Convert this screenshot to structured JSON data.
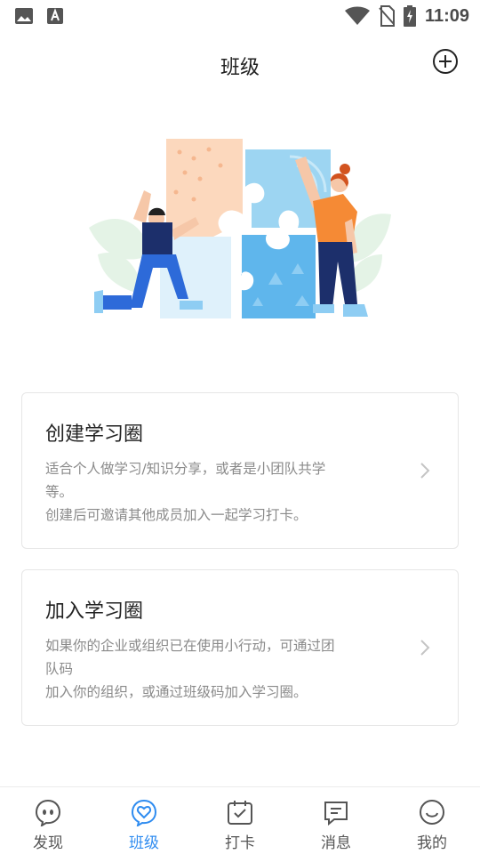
{
  "status_bar": {
    "time": "11:09",
    "left_icons": [
      "image-icon",
      "font-app-icon"
    ],
    "right_icons": [
      "wifi-icon",
      "no-sim-icon",
      "battery-charging-icon"
    ]
  },
  "header": {
    "title": "班级",
    "add_icon": "plus-circle-icon"
  },
  "illustration": {
    "subject": "two-people-assembling-puzzle"
  },
  "cards": [
    {
      "title": "创建学习圈",
      "desc_line1": "适合个人做学习/知识分享，或者是小团队共学",
      "desc_line2": "等。",
      "desc_line3": "创建后可邀请其他成员加入一起学习打卡。"
    },
    {
      "title": "加入学习圈",
      "desc_line1": "如果你的企业或组织已在使用小行动，可通过团",
      "desc_line2": "队码",
      "desc_line3": "加入你的组织，或通过班级码加入学习圈。"
    }
  ],
  "tab_bar": {
    "active_index": 1,
    "active_color": "#2f8cf0",
    "inactive_color": "#555555",
    "tabs": [
      {
        "label": "发现",
        "icon": "discover-face-icon"
      },
      {
        "label": "班级",
        "icon": "class-heart-icon"
      },
      {
        "label": "打卡",
        "icon": "checkin-calendar-icon"
      },
      {
        "label": "消息",
        "icon": "message-icon"
      },
      {
        "label": "我的",
        "icon": "profile-smile-icon"
      }
    ]
  }
}
